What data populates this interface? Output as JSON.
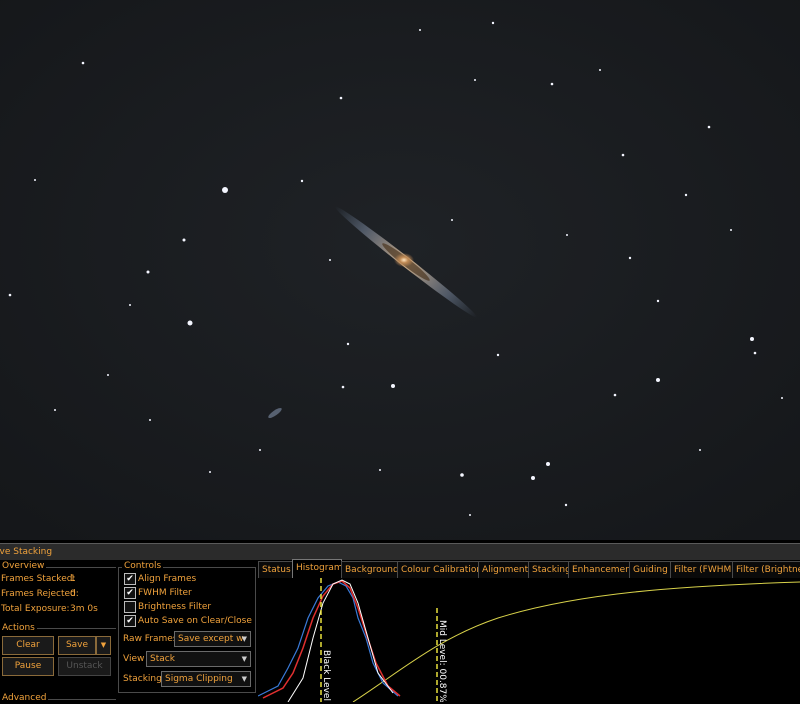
{
  "panel_title": "ive Stacking",
  "overview": {
    "label": "Overview",
    "frames_stacked_label": "Frames Stacked:",
    "frames_stacked_value": "1",
    "frames_rejected_label": "Frames Rejected:",
    "frames_rejected_value": "0",
    "total_exposure_label": "Total Exposure:",
    "total_exposure_value": "3m 0s"
  },
  "actions": {
    "label": "Actions",
    "clear": "Clear",
    "save": "Save",
    "pause": "Pause",
    "unstack": "Unstack"
  },
  "advanced": {
    "label": "Advanced"
  },
  "controls": {
    "label": "Controls",
    "align_frames": "Align Frames",
    "fwhm_filter": "FWHM Filter",
    "brightness_filter": "Brightness Filter",
    "auto_save": "Auto Save on Clear/Close",
    "raw_frames_label": "Raw Frames",
    "raw_frames_value": "Save except w",
    "view_label": "View",
    "view_value": "Stack",
    "stacking_label": "Stacking",
    "stacking_value": "Sigma Clipping"
  },
  "tabs": [
    "Status",
    "Histogram",
    "Background",
    "Colour Calibration",
    "Alignment",
    "Stacking",
    "Enhancement",
    "Guiding",
    "Filter (FWHM)",
    "Filter (Brightne"
  ],
  "active_tab": "Histogram",
  "histogram": {
    "black_level_label": "Black Level: 0",
    "mid_level_label": "Mid Level: 00.87%"
  },
  "colors": {
    "accent": "#f0a23c",
    "curve": "#d8d24a",
    "marker": "#e8e03c"
  },
  "icons": {
    "dropdown": "chevron-down-icon",
    "check": "checkmark-icon"
  }
}
